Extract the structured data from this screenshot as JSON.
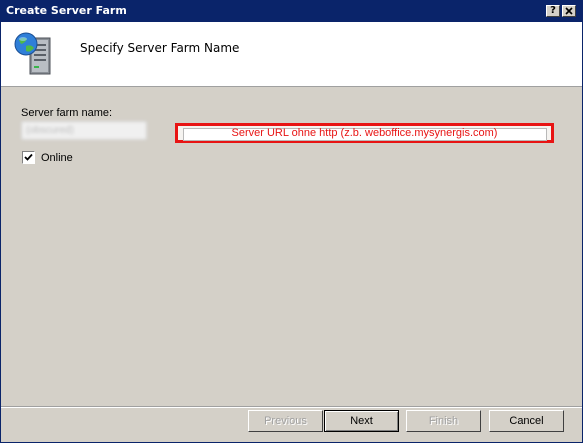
{
  "window": {
    "title": "Create Server Farm",
    "help_button": "?",
    "close_button": "✕"
  },
  "header": {
    "heading": "Specify Server Farm Name",
    "icon": "server-globe-icon"
  },
  "form": {
    "server_farm_label": "Server farm name:",
    "server_farm_value": "(obscured)",
    "online_label": "Online",
    "online_checked": true
  },
  "annotation": {
    "text": "Server URL ohne http (z.b. weboffice.mysynergis.com)",
    "color": "#e81414"
  },
  "buttons": {
    "previous": "Previous",
    "next": "Next",
    "finish": "Finish",
    "cancel": "Cancel"
  }
}
